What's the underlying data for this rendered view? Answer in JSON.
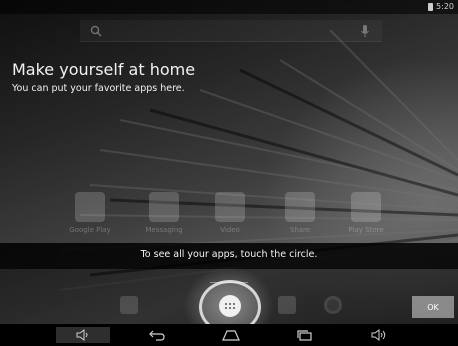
{
  "status_bar": {
    "time": "5:20"
  },
  "cling": {
    "title": "Make yourself at home",
    "subtitle": "You can put your favorite apps here.",
    "all_apps_hint": "To see all your apps, touch the circle.",
    "ok_label": "OK"
  },
  "hotseat_apps": [
    {
      "label": "Google Play",
      "icon": "play-store-icon"
    },
    {
      "label": "Messaging",
      "icon": "messaging-icon"
    },
    {
      "label": "Video",
      "icon": "video-clapper-icon"
    },
    {
      "label": "Share",
      "icon": "share-icon"
    },
    {
      "label": "Play Store",
      "icon": "play-store-icon"
    }
  ],
  "nav_bar": [
    "volume-down-icon",
    "back-icon",
    "home-icon",
    "recent-apps-icon",
    "volume-up-icon"
  ],
  "colors": {
    "nav_bg": "#000000",
    "cling_overlay": "rgba(0,0,0,0.55)"
  }
}
